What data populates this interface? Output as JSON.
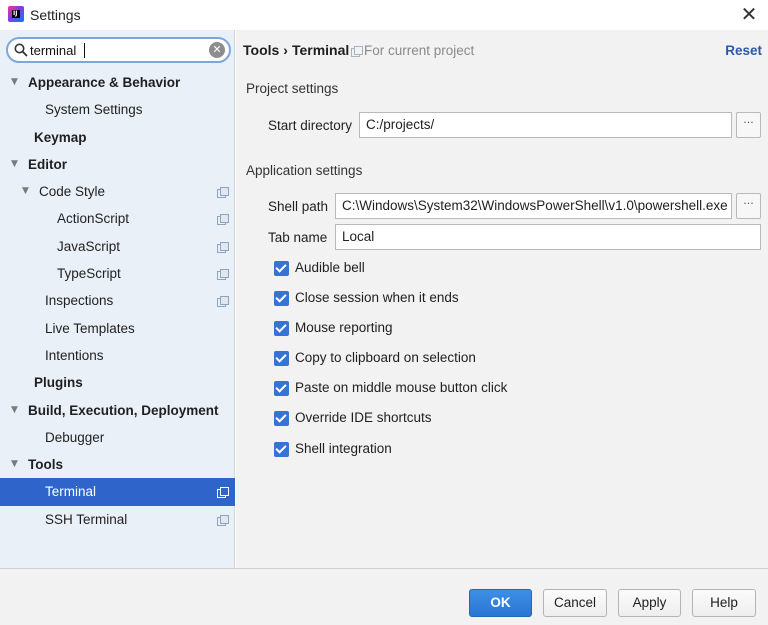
{
  "window": {
    "title": "Settings",
    "app_icon_letter": "IJ",
    "close_glyph": "✕"
  },
  "sidebar": {
    "search": {
      "value": "terminal",
      "clear_glyph": "✕"
    },
    "items": [
      {
        "label": "Appearance & Behavior",
        "bold": true,
        "arrow": "▼"
      },
      {
        "label": "System Settings"
      },
      {
        "label": "Keymap",
        "bold": true
      },
      {
        "label": "Editor",
        "bold": true,
        "arrow": "▼"
      },
      {
        "label": "Code Style",
        "arrow": "▼"
      },
      {
        "label": "ActionScript"
      },
      {
        "label": "JavaScript"
      },
      {
        "label": "TypeScript"
      },
      {
        "label": "Inspections"
      },
      {
        "label": "Live Templates"
      },
      {
        "label": "Intentions"
      },
      {
        "label": "Plugins",
        "bold": true
      },
      {
        "label": "Build, Execution, Deployment",
        "bold": true,
        "arrow": "▼"
      },
      {
        "label": "Debugger"
      },
      {
        "label": "Tools",
        "bold": true,
        "arrow": "▼"
      },
      {
        "label": "Terminal",
        "selected": true
      },
      {
        "label": "SSH Terminal"
      }
    ]
  },
  "main": {
    "breadcrumb": {
      "parent": "Tools",
      "separator": "›",
      "current": "Terminal"
    },
    "scope_label": "For current project",
    "reset_label": "Reset",
    "project_section": "Project settings",
    "start_directory": {
      "label": "Start directory",
      "value": "C:/projects/"
    },
    "application_section": "Application settings",
    "shell_path": {
      "label": "Shell path",
      "value": "C:\\Windows\\System32\\WindowsPowerShell\\v1.0\\powershell.exe"
    },
    "tab_name": {
      "label": "Tab name",
      "value": "Local"
    },
    "browse_glyph": "···",
    "checkboxes": [
      {
        "label": "Audible bell",
        "checked": true
      },
      {
        "label": "Close session when it ends",
        "checked": true
      },
      {
        "label": "Mouse reporting",
        "checked": true
      },
      {
        "label": "Copy to clipboard on selection",
        "checked": true
      },
      {
        "label": "Paste on middle mouse button click",
        "checked": true
      },
      {
        "label": "Override IDE shortcuts",
        "checked": true
      },
      {
        "label": "Shell integration",
        "checked": true
      }
    ]
  },
  "footer": {
    "ok_label": "OK",
    "cancel_label": "Cancel",
    "apply_label": "Apply",
    "help_label": "Help"
  },
  "colors": {
    "accent": "#2f65ca",
    "checkbox": "#3574d4",
    "link": "#2c58a8",
    "sidebar_bg": "#eaf0f7"
  }
}
